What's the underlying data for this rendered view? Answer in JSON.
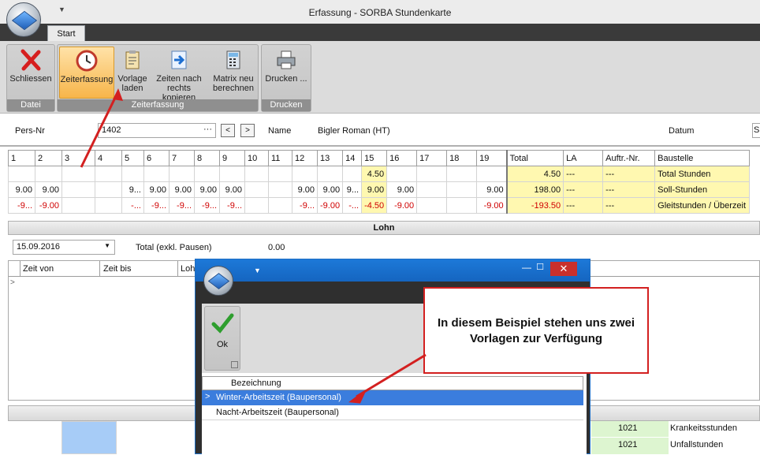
{
  "window": {
    "title": "Erfassung - SORBA Stundenkarte"
  },
  "tabs": [
    "Start"
  ],
  "ribbon": {
    "groups": [
      {
        "label": "Datei",
        "buttons": [
          {
            "label": "Schliessen",
            "icon": "close-x-icon"
          }
        ]
      },
      {
        "label": "Zeiterfassung",
        "buttons": [
          {
            "label": "Zeiterfassung",
            "icon": "clock-icon",
            "active": true
          },
          {
            "label": "Vorlage laden",
            "icon": "clipboard-icon"
          },
          {
            "label": "Zeiten nach rechts kopieren",
            "icon": "copy-right-icon"
          },
          {
            "label": "Matrix neu berechnen",
            "icon": "calculator-icon"
          }
        ]
      },
      {
        "label": "Drucken",
        "buttons": [
          {
            "label": "Drucken ...",
            "icon": "printer-icon"
          }
        ]
      }
    ]
  },
  "person": {
    "pers_nr_label": "Pers-Nr",
    "pers_nr_value": "1402",
    "ellipsis": "···",
    "prev": "<",
    "next": ">",
    "name_label": "Name",
    "name_value": "Bigler Roman (HT)",
    "datum_label": "Datum",
    "datum_value_partial": "S"
  },
  "grid": {
    "day_headers": [
      "1",
      "2",
      "3",
      "4",
      "5",
      "6",
      "7",
      "8",
      "9",
      "10",
      "11",
      "12",
      "13",
      "14",
      "15",
      "16",
      "17",
      "18",
      "19"
    ],
    "summary_headers": [
      "Total",
      "LA",
      "Auftr.-Nr.",
      "Baustelle"
    ],
    "rows": [
      {
        "days": [
          "",
          "",
          "",
          "",
          "",
          "",
          "",
          "",
          "",
          "",
          "",
          "",
          "",
          "",
          "4.50",
          "",
          "",
          "",
          ""
        ],
        "total": "4.50",
        "la": "---",
        "auftr": "---",
        "baustelle": "Total Stunden",
        "red": false
      },
      {
        "days": [
          "9.00",
          "9.00",
          "",
          "",
          "9...",
          "9.00",
          "9.00",
          "9.00",
          "9.00",
          "",
          "",
          "9.00",
          "9.00",
          "9...",
          "9.00",
          "9.00",
          "",
          "",
          "9.00"
        ],
        "total": "198.00",
        "la": "---",
        "auftr": "---",
        "baustelle": "Soll-Stunden",
        "red": false
      },
      {
        "days": [
          "-9...",
          "-9.00",
          "",
          "",
          "-...",
          "-9...",
          "-9...",
          "-9...",
          "-9...",
          "",
          "",
          "-9...",
          "-9.00",
          "-...",
          "-4.50",
          "-9.00",
          "",
          "",
          "-9.00"
        ],
        "total": "-193.50",
        "la": "---",
        "auftr": "---",
        "baustelle": "Gleitstunden / Überzeit",
        "red": true
      }
    ]
  },
  "lohn": {
    "section_label": "Lohn",
    "date_value": "15.09.2016",
    "total_label": "Total (exkl. Pausen)",
    "total_value": "0.00",
    "col_zeit_von": "Zeit von",
    "col_zeit_bis": "Zeit bis",
    "col_lohn_partial": "Loh"
  },
  "bottom_rows": [
    {
      "auftr": "1021",
      "baustelle": "Krankeitsstunden"
    },
    {
      "auftr": "1021",
      "baustelle": "Unfallstunden"
    }
  ],
  "dialog": {
    "ok_label": "Ok",
    "close_symbol": "✕",
    "min_symbol": "—",
    "max_symbol": "☐",
    "column_header": "Bezeichnung",
    "items": [
      "Winter-Arbeitszeit (Baupersonal)",
      "Nacht-Arbeitszeit (Baupersonal)"
    ],
    "selected_index": 0
  },
  "callout": {
    "text": "In diesem Beispiel stehen uns zwei Vorlagen zur Verfügung"
  },
  "colors": {
    "accent_red": "#d32020",
    "selection_blue": "#3b7ddd",
    "highlight_yellow": "#fff8b0"
  }
}
